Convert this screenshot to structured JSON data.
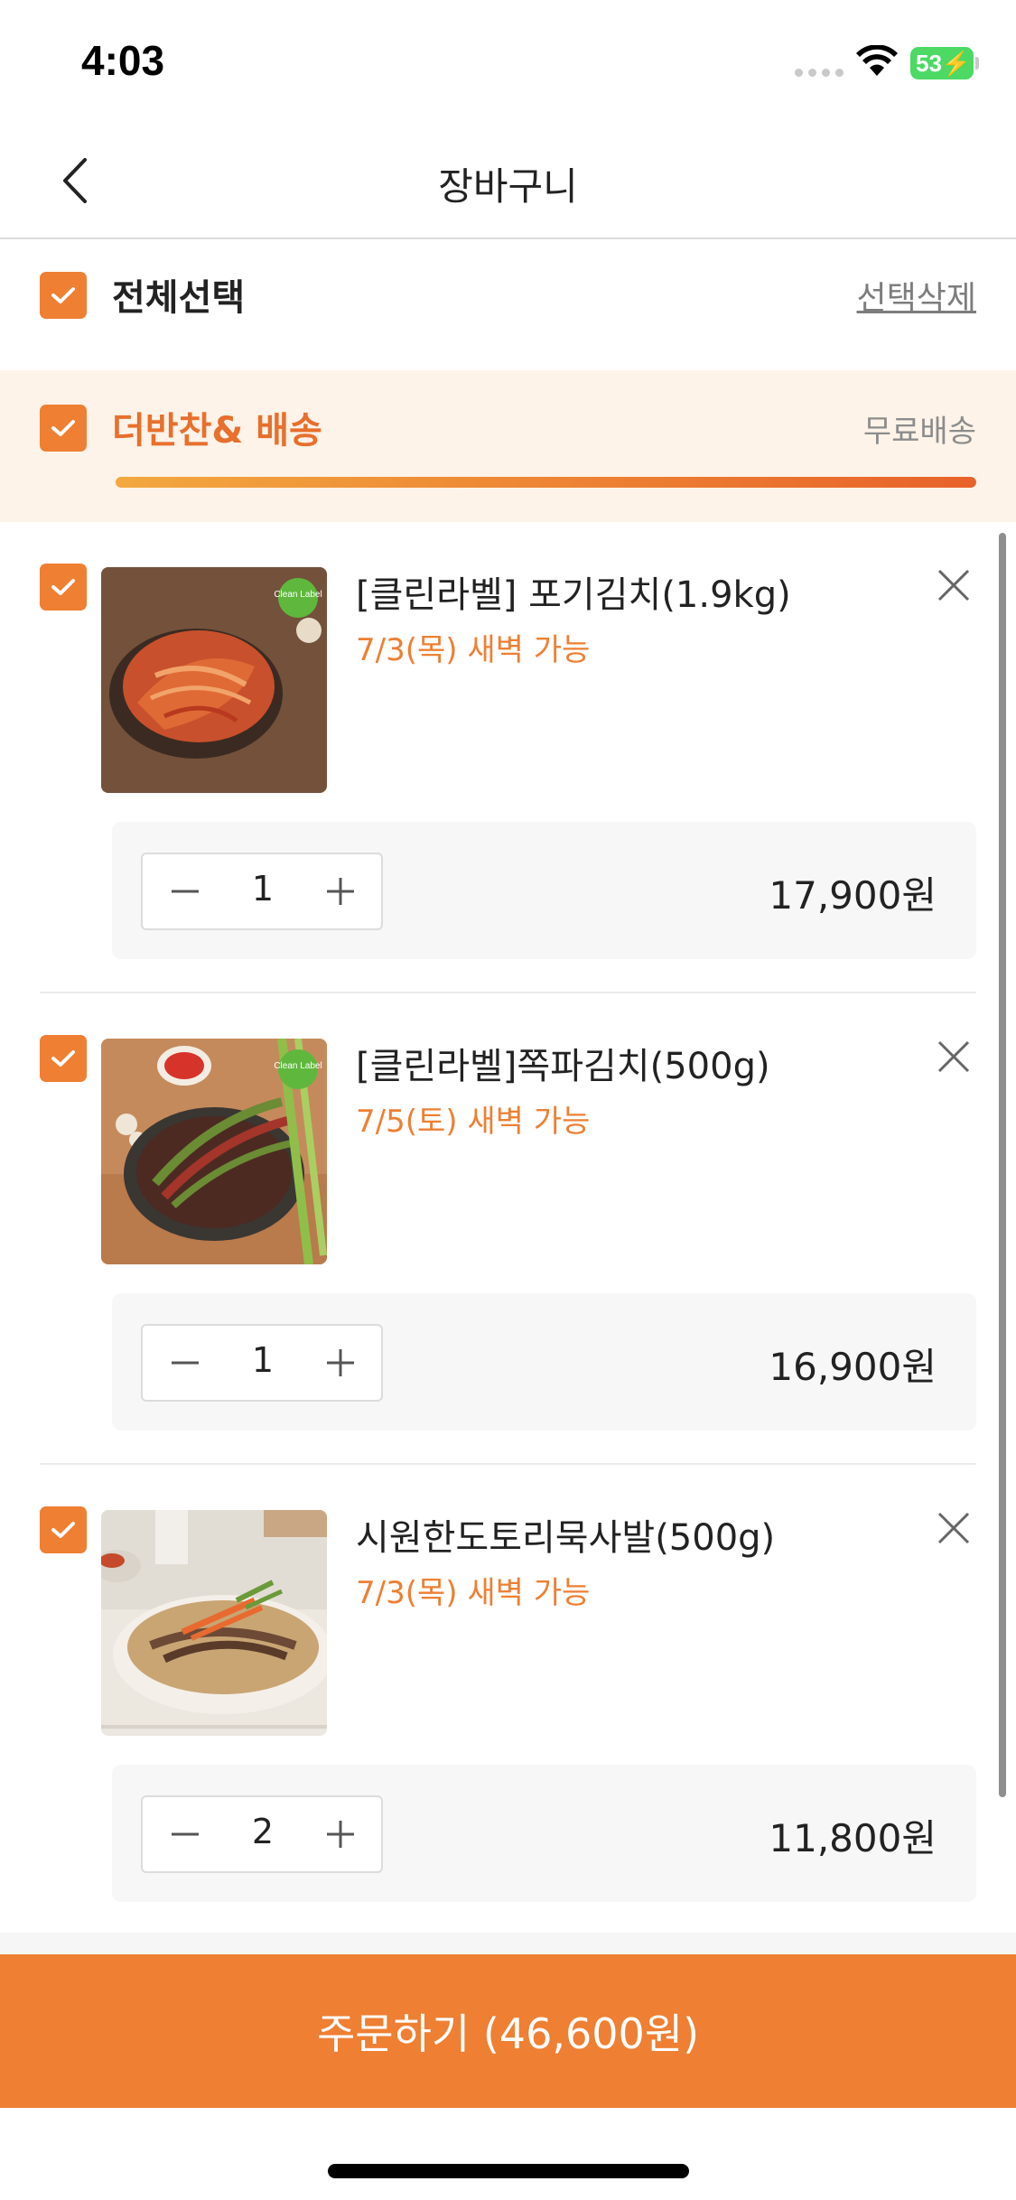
{
  "status_bar": {
    "time": "4:03",
    "battery": "53"
  },
  "nav": {
    "title": "장바구니"
  },
  "select_all": {
    "label": "전체선택",
    "delete_label": "선택삭제"
  },
  "group": {
    "title": "더반찬& 배송",
    "shipping": "무료배송",
    "progress": 1.0
  },
  "items": [
    {
      "name": "[클린라벨] 포기김치(1.9kg)",
      "delivery": "7/3(목) 새벽 가능",
      "quantity": "1",
      "price": "17,900원",
      "badge": "Clean Label"
    },
    {
      "name": "[클린라벨]쪽파김치(500g)",
      "delivery": "7/5(토) 새벽 가능",
      "quantity": "1",
      "price": "16,900원",
      "badge": "Clean Label"
    },
    {
      "name": "시원한도토리묵사발(500g)",
      "delivery": "7/3(목) 새벽 가능",
      "quantity": "2",
      "price": "11,800원"
    }
  ],
  "order": {
    "label": "주문하기 (46,600원)"
  },
  "colors": {
    "accent": "#EE7F33",
    "group_bg": "#FDF3E8"
  }
}
